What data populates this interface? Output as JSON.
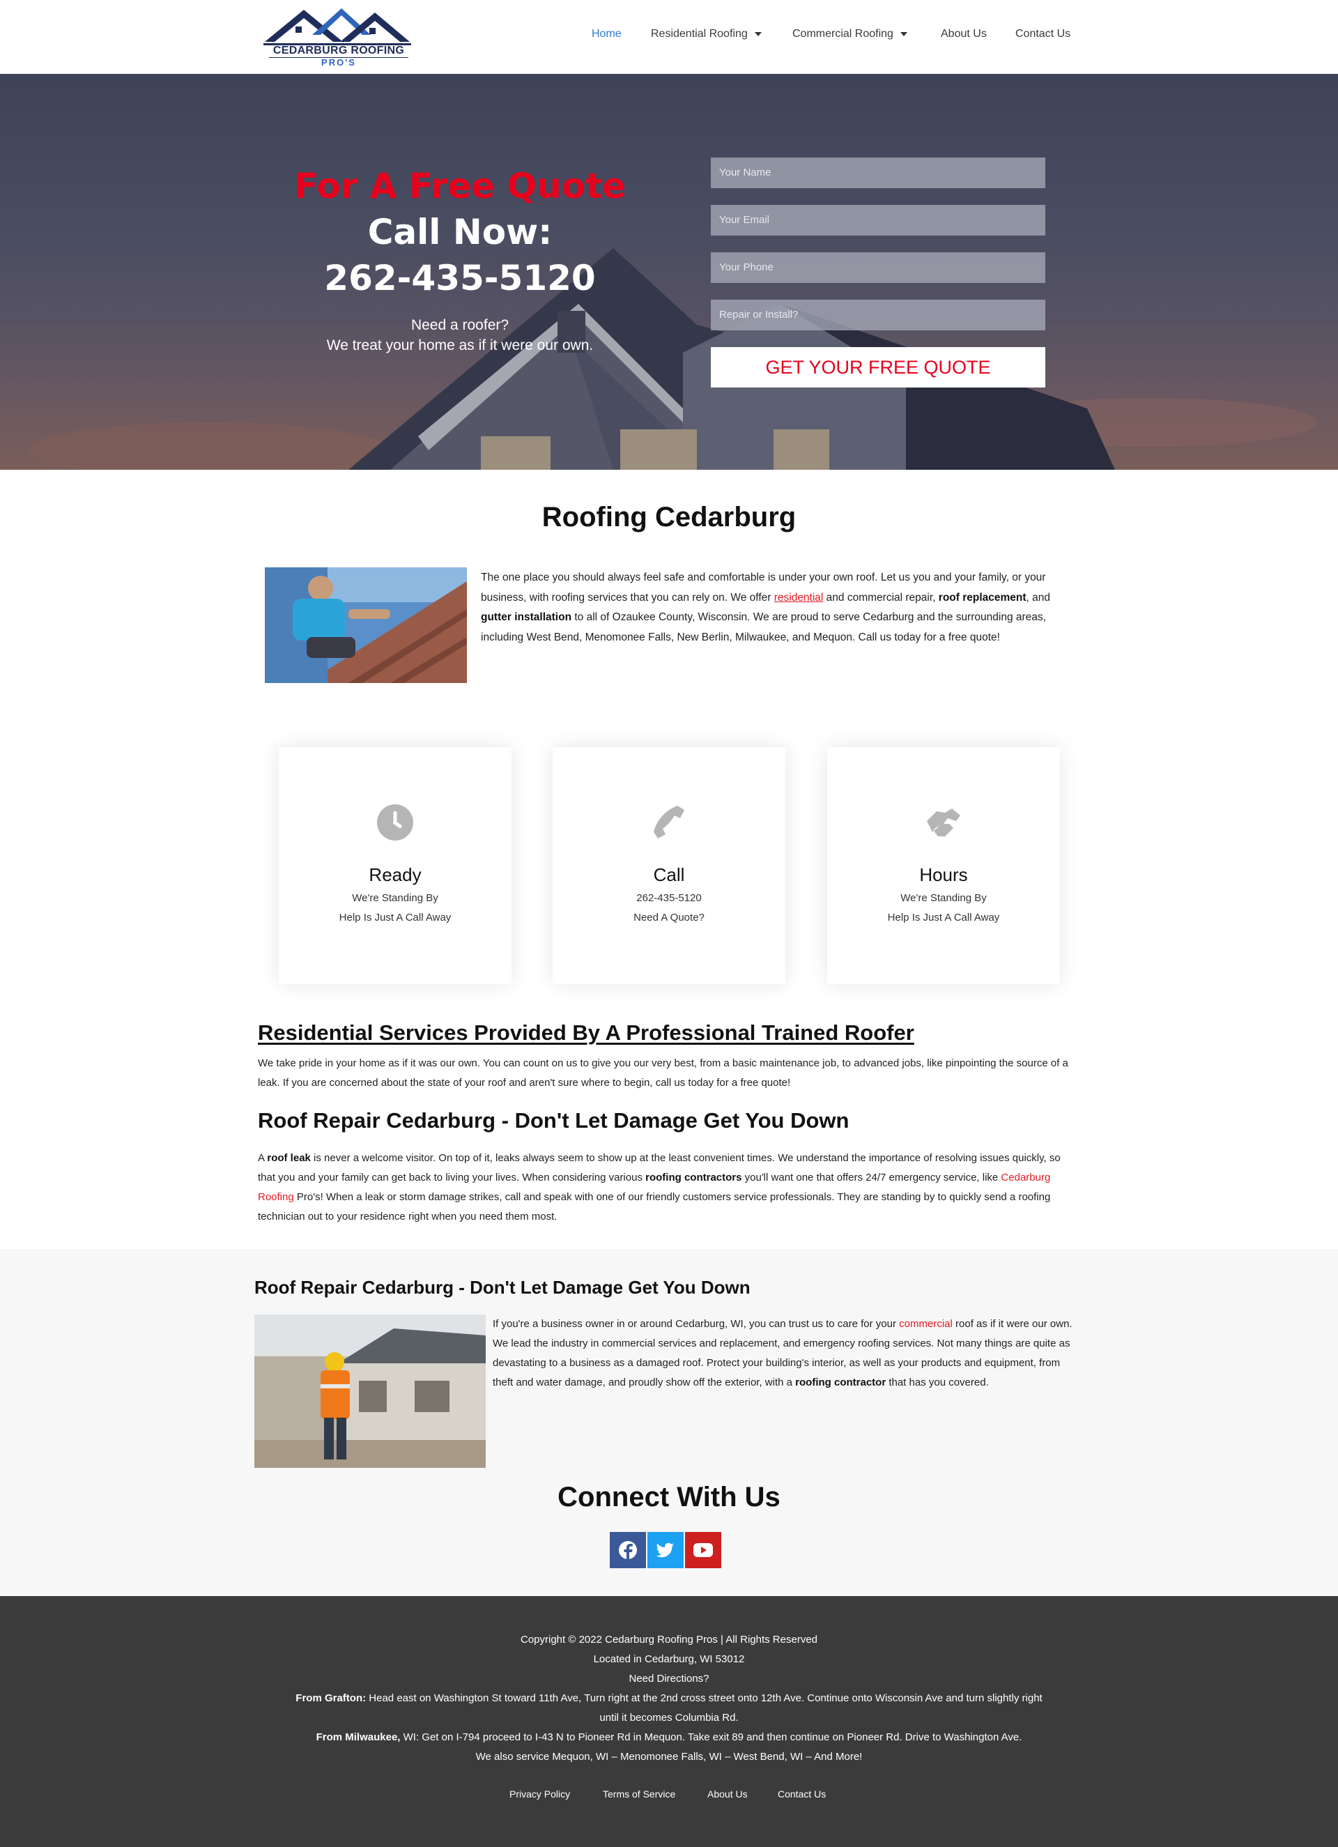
{
  "header": {
    "logo_line1": "CEDARBURG ROOFING",
    "logo_line2": "PRO'S",
    "nav": [
      {
        "label": "Home"
      },
      {
        "label": "Residential Roofing"
      },
      {
        "label": "Commercial Roofing"
      },
      {
        "label": "About Us"
      },
      {
        "label": "Contact Us"
      }
    ]
  },
  "hero": {
    "line1": "For A Free Quote",
    "line2": "Call Now:",
    "phone": "262-435-5120",
    "sub1": "Need a roofer?",
    "sub2": "We treat your home as if it were our own.",
    "form": {
      "name_placeholder": "Your Name",
      "email_placeholder": "Your Email",
      "phone_placeholder": "Your Phone",
      "type_placeholder": "Repair or Install?",
      "submit_label": "GET YOUR FREE QUOTE"
    }
  },
  "intro": {
    "title": "Roofing Cedarburg",
    "t1": "The one place you should always feel safe and comfortable is under your own roof. Let us you and your family, or your business, with roofing services that you can rely on. We offer ",
    "link": "residential",
    "t2": " and commercial repair, ",
    "b1": "roof replacement",
    "t3": ", and ",
    "b2": "gutter installation",
    "t4": " to all of Ozaukee County, Wisconsin. We are proud to serve Cedarburg and the surrounding areas, including West Bend, Menomonee Falls, New Berlin, Milwaukee, and Mequon. Call us today for a free quote!"
  },
  "cards": [
    {
      "title": "Ready",
      "line1": "We're Standing By",
      "line2": "Help Is Just A Call Away",
      "icon": "clock-icon"
    },
    {
      "title": "Call",
      "line1": "262-435-5120",
      "line2": "Need A Quote?",
      "icon": "phone-icon"
    },
    {
      "title": "Hours",
      "line1": "We're Standing By",
      "line2": "Help Is Just A Call Away",
      "icon": "handshake-icon"
    }
  ],
  "residential": {
    "title": "Residential Services Provided By A Professional Trained Roofer",
    "text": "We take pride in your home as if it was our own. You can count on us to give you our very best, from a basic maintenance job, to advanced jobs, like pinpointing the source of a leak. If you are concerned about the state of your roof and aren't sure where to begin, call us today for a free quote!"
  },
  "repair": {
    "title": "Roof Repair Cedarburg - Don't Let Damage Get You Down",
    "t1": "A ",
    "b1": "roof leak",
    "t2": " is never a welcome visitor. On top of it, leaks always seem to show up at the least convenient times. We understand the importance of resolving issues quickly, so that you and your family can get back to living your lives. When considering various ",
    "b2": "roofing contractors",
    "t3": " you'll want one that offers 24/7 emergency service, like ",
    "link": "Cedarburg Roofing",
    "t4": " Pro's! When a leak or storm damage strikes, call and speak with one of our friendly customers service professionals. They are standing by to quickly send a roofing technician out to your residence right when you need them most."
  },
  "commercial": {
    "title": "Roof Repair Cedarburg - Don't Let Damage Get You Down",
    "t1": "If you're a business owner in or around Cedarburg, WI, you can trust us to care for your ",
    "link": "commercial",
    "t2": " roof as if it were our own. We lead the industry in commercial services and replacement, and emergency roofing services. Not many things are quite as devastating to a business as a damaged roof. Protect your building's interior, as well as your products and equipment, from theft and water damage, and proudly show off the exterior, with a ",
    "b1": "roofing contractor",
    "t3": " that has you covered."
  },
  "connect": {
    "title": "Connect With Us",
    "social": [
      {
        "icon": "facebook-icon",
        "color": "#3b5998"
      },
      {
        "icon": "twitter-icon",
        "color": "#1da1f2"
      },
      {
        "icon": "youtube-icon",
        "color": "#cd201f"
      }
    ]
  },
  "footer": {
    "copyright": "Copyright © 2022 Cedarburg Roofing Pros | All Rights Reserved",
    "location": "Located in Cedarburg, WI 53012",
    "directions": "Need Directions?",
    "grafton_label": "From Grafton:",
    "grafton_text": " Head east on Washington St toward 11th Ave, Turn right at the 2nd cross street onto 12th Ave. Continue onto Wisconsin Ave and turn slightly right",
    "grafton_text2": "until it becomes Columbia Rd.",
    "milwaukee_label": "From Milwaukee,",
    "milwaukee_text": " WI: Get on I-794 proceed to I-43 N to Pioneer Rd in Mequon. Take exit 89 and then continue on Pioneer Rd. Drive to Washington Ave.",
    "service": "We also service Mequon, WI – Menomonee Falls, WI – West Bend, WI – And More!",
    "links": [
      "Privacy Policy",
      "Terms of Service",
      "About Us",
      "Contact Us"
    ]
  }
}
